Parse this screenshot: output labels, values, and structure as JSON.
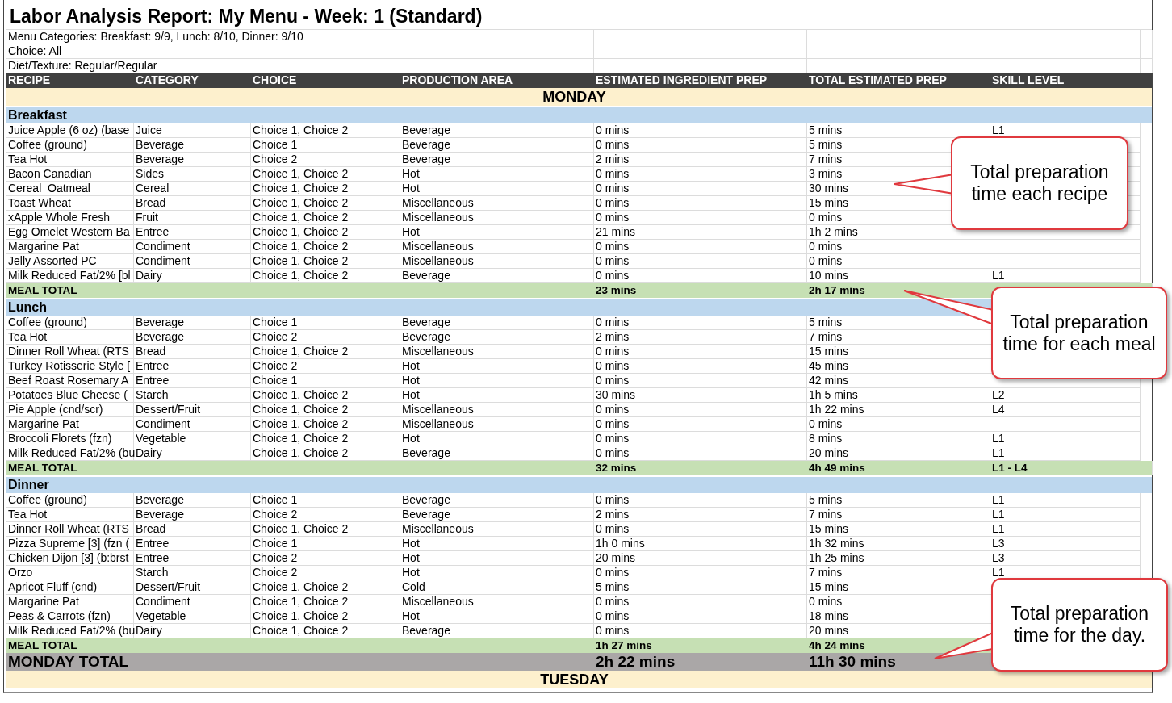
{
  "title": "Labor Analysis Report: My Menu - Week: 1 (Standard)",
  "info": [
    "Menu Categories: Breakfast: 9/9, Lunch: 8/10, Dinner: 9/10",
    "Choice: All",
    "Diet/Texture: Regular/Regular"
  ],
  "columns": [
    "RECIPE",
    "CATEGORY",
    "CHOICE",
    "PRODUCTION AREA",
    "ESTIMATED INGREDIENT PREP",
    "TOTAL ESTIMATED PREP",
    "SKILL LEVEL"
  ],
  "day": "MONDAY",
  "meals": [
    {
      "name": "Breakfast",
      "rows": [
        {
          "recipe": "Juice Apple (6 oz) (base",
          "category": "Juice",
          "choice": "Choice 1, Choice 2",
          "area": "Beverage",
          "ingredient_prep": "0 mins",
          "total_prep": "5 mins",
          "skill": "L1"
        },
        {
          "recipe": "Coffee (ground)",
          "category": "Beverage",
          "choice": "Choice 1",
          "area": "Beverage",
          "ingredient_prep": "0 mins",
          "total_prep": "5 mins"
        },
        {
          "recipe": "Tea Hot",
          "category": "Beverage",
          "choice": "Choice 2",
          "area": "Beverage",
          "ingredient_prep": "2 mins",
          "total_prep": "7 mins"
        },
        {
          "recipe": "Bacon Canadian",
          "category": "Sides",
          "choice": "Choice 1, Choice 2",
          "area": "Hot",
          "ingredient_prep": "0 mins",
          "total_prep": "3 mins"
        },
        {
          "recipe": "Cereal  Oatmeal",
          "category": "Cereal",
          "choice": "Choice 1, Choice 2",
          "area": "Hot",
          "ingredient_prep": "0 mins",
          "total_prep": "30 mins"
        },
        {
          "recipe": "Toast Wheat",
          "category": "Bread",
          "choice": "Choice 1, Choice 2",
          "area": "Miscellaneous",
          "ingredient_prep": "0 mins",
          "total_prep": "15 mins"
        },
        {
          "recipe": "xApple Whole Fresh",
          "category": "Fruit",
          "choice": "Choice 1, Choice 2",
          "area": "Miscellaneous",
          "ingredient_prep": "0 mins",
          "total_prep": "0 mins"
        },
        {
          "recipe": "Egg Omelet Western Ba",
          "category": "Entree",
          "choice": "Choice 1, Choice 2",
          "area": "Hot",
          "ingredient_prep": "21 mins",
          "total_prep": "1h 2 mins"
        },
        {
          "recipe": "Margarine Pat",
          "category": "Condiment",
          "choice": "Choice 1, Choice 2",
          "area": "Miscellaneous",
          "ingredient_prep": "0 mins",
          "total_prep": "0 mins"
        },
        {
          "recipe": "Jelly Assorted PC",
          "category": "Condiment",
          "choice": "Choice 1, Choice 2",
          "area": "Miscellaneous",
          "ingredient_prep": "0 mins",
          "total_prep": "0 mins"
        },
        {
          "recipe": "Milk Reduced Fat/2% [bl",
          "category": "Dairy",
          "choice": "Choice 1, Choice 2",
          "area": "Beverage",
          "ingredient_prep": "0 mins",
          "total_prep": "10 mins",
          "skill": "L1"
        }
      ],
      "total": {
        "label": "MEAL TOTAL",
        "ingredient_prep": "23 mins",
        "total_prep": "2h 17 mins"
      }
    },
    {
      "name": "Lunch",
      "rows": [
        {
          "recipe": "Coffee (ground)",
          "category": "Beverage",
          "choice": "Choice 1",
          "area": "Beverage",
          "ingredient_prep": "0 mins",
          "total_prep": "5 mins"
        },
        {
          "recipe": "Tea Hot",
          "category": "Beverage",
          "choice": "Choice 2",
          "area": "Beverage",
          "ingredient_prep": "2 mins",
          "total_prep": "7 mins"
        },
        {
          "recipe": "Dinner Roll Wheat (RTS",
          "category": "Bread",
          "choice": "Choice 1, Choice 2",
          "area": "Miscellaneous",
          "ingredient_prep": "0 mins",
          "total_prep": "15 mins"
        },
        {
          "recipe": "Turkey Rotisserie Style [",
          "category": "Entree",
          "choice": "Choice 2",
          "area": "Hot",
          "ingredient_prep": "0 mins",
          "total_prep": "45 mins"
        },
        {
          "recipe": "Beef Roast Rosemary A",
          "category": "Entree",
          "choice": "Choice 1",
          "area": "Hot",
          "ingredient_prep": "0 mins",
          "total_prep": "42 mins"
        },
        {
          "recipe": "Potatoes Blue Cheese (",
          "category": "Starch",
          "choice": "Choice 1, Choice 2",
          "area": "Hot",
          "ingredient_prep": "30 mins",
          "total_prep": "1h 5 mins",
          "skill": "L2"
        },
        {
          "recipe": "Pie Apple (cnd/scr)",
          "category": "Dessert/Fruit",
          "choice": "Choice 1, Choice 2",
          "area": "Miscellaneous",
          "ingredient_prep": "0 mins",
          "total_prep": "1h 22 mins",
          "skill": "L4"
        },
        {
          "recipe": "Margarine Pat",
          "category": "Condiment",
          "choice": "Choice 1, Choice 2",
          "area": "Miscellaneous",
          "ingredient_prep": "0 mins",
          "total_prep": "0 mins"
        },
        {
          "recipe": "Broccoli Florets (fzn)",
          "category": "Vegetable",
          "choice": "Choice 1, Choice 2",
          "area": "Hot",
          "ingredient_prep": "0 mins",
          "total_prep": "8 mins",
          "skill": "L1"
        },
        {
          "recipe": "Milk Reduced Fat/2% (bu",
          "category": "Dairy",
          "choice": "Choice 1, Choice 2",
          "area": "Beverage",
          "ingredient_prep": "0 mins",
          "total_prep": "20 mins",
          "skill": "L1"
        }
      ],
      "total": {
        "label": "MEAL TOTAL",
        "ingredient_prep": "32 mins",
        "total_prep": "4h 49 mins",
        "skill": "L1 - L4"
      }
    },
    {
      "name": "Dinner",
      "rows": [
        {
          "recipe": "Coffee (ground)",
          "category": "Beverage",
          "choice": "Choice 1",
          "area": "Beverage",
          "ingredient_prep": "0 mins",
          "total_prep": "5 mins",
          "skill": "L1"
        },
        {
          "recipe": "Tea Hot",
          "category": "Beverage",
          "choice": "Choice 2",
          "area": "Beverage",
          "ingredient_prep": "2 mins",
          "total_prep": "7 mins",
          "skill": "L1"
        },
        {
          "recipe": "Dinner Roll Wheat (RTS",
          "category": "Bread",
          "choice": "Choice 1, Choice 2",
          "area": "Miscellaneous",
          "ingredient_prep": "0 mins",
          "total_prep": "15 mins",
          "skill": "L1"
        },
        {
          "recipe": "Pizza Supreme [3] (fzn (",
          "category": "Entree",
          "choice": "Choice 1",
          "area": "Hot",
          "ingredient_prep": "1h 0 mins",
          "total_prep": "1h 32 mins",
          "skill": "L3"
        },
        {
          "recipe": "Chicken Dijon [3] (b:brst",
          "category": "Entree",
          "choice": "Choice 2",
          "area": "Hot",
          "ingredient_prep": "20 mins",
          "total_prep": "1h 25 mins",
          "skill": "L3"
        },
        {
          "recipe": "Orzo",
          "category": "Starch",
          "choice": "Choice 2",
          "area": "Hot",
          "ingredient_prep": "0 mins",
          "total_prep": "7 mins",
          "skill": "L1"
        },
        {
          "recipe": "Apricot Fluff (cnd)",
          "category": "Dessert/Fruit",
          "choice": "Choice 1, Choice 2",
          "area": "Cold",
          "ingredient_prep": "5 mins",
          "total_prep": "15 mins"
        },
        {
          "recipe": "Margarine Pat",
          "category": "Condiment",
          "choice": "Choice 1, Choice 2",
          "area": "Miscellaneous",
          "ingredient_prep": "0 mins",
          "total_prep": "0 mins"
        },
        {
          "recipe": "Peas & Carrots (fzn)",
          "category": "Vegetable",
          "choice": "Choice 1, Choice 2",
          "area": "Hot",
          "ingredient_prep": "0 mins",
          "total_prep": "18 mins"
        },
        {
          "recipe": "Milk Reduced Fat/2% (bu",
          "category": "Dairy",
          "choice": "Choice 1, Choice 2",
          "area": "Beverage",
          "ingredient_prep": "0 mins",
          "total_prep": "20 mins"
        }
      ],
      "total": {
        "label": "MEAL TOTAL",
        "ingredient_prep": "1h 27 mins",
        "total_prep": "4h 24 mins"
      }
    }
  ],
  "day_total": {
    "label": "MONDAY TOTAL",
    "ingredient_prep": "2h 22 mins",
    "total_prep": "11h 30 mins"
  },
  "next_day": "TUESDAY",
  "callouts": [
    "Total preparation time each recipe",
    "Total preparation time for each meal",
    "Total preparation time for the day."
  ]
}
